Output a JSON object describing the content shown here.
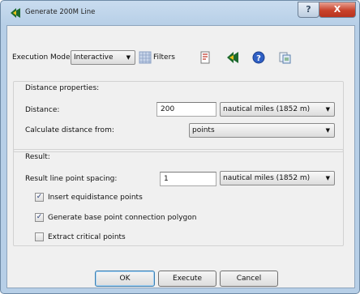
{
  "window": {
    "title": "Generate 200M Line",
    "help_glyph": "?",
    "close_glyph": "X"
  },
  "toolbar": {
    "execution_mode_label": "Execution Mode:",
    "execution_mode_value": "Interactive",
    "filters_label": "Filters",
    "icons": [
      "filters-grid-icon",
      "report-icon",
      "app-logo-icon",
      "help-icon",
      "copy-icon"
    ]
  },
  "distance_group": {
    "title": "Distance properties:",
    "distance_label": "Distance:",
    "distance_value": "200",
    "distance_unit": "nautical miles (1852 m)",
    "calc_from_label": "Calculate distance from:",
    "calc_from_value": "points"
  },
  "result_group": {
    "title": "Result:",
    "spacing_label": "Result line point spacing:",
    "spacing_value": "1",
    "spacing_unit": "nautical miles (1852 m)",
    "checkboxes": [
      {
        "label": "Insert equidistance points",
        "checked": true
      },
      {
        "label": "Generate base point connection polygon",
        "checked": true
      },
      {
        "label": "Extract critical points",
        "checked": false
      }
    ]
  },
  "buttons": {
    "ok": "OK",
    "execute": "Execute",
    "cancel": "Cancel"
  },
  "colors": {
    "title_gradient": "#b7cfe7",
    "close_red": "#c8422b",
    "panel": "#f0f0f0"
  }
}
